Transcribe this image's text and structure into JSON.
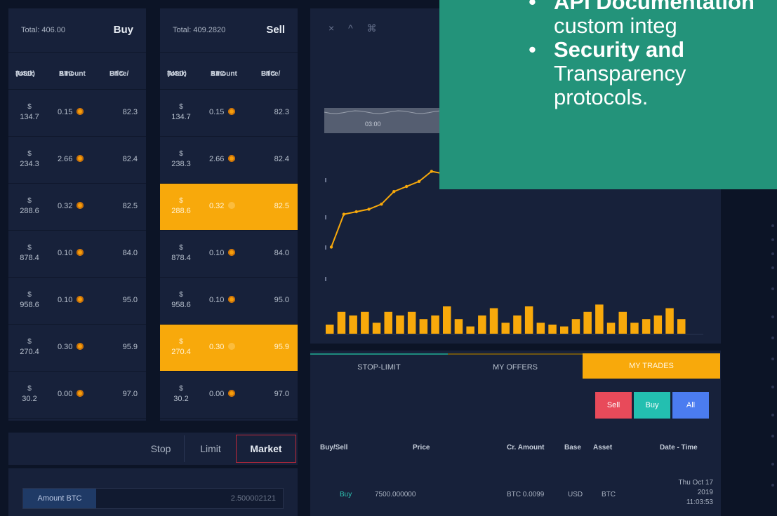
{
  "buy_book": {
    "total": "Total: 406.00",
    "side": "Buy",
    "columns": [
      {
        "l1": "Total:",
        "l2": "(USD)"
      },
      {
        "l1": "BTC",
        "l2": "Amount"
      },
      {
        "l1": "Price/",
        "l2": "BTC"
      }
    ],
    "rows": [
      {
        "sym": "$",
        "usd": "134.7",
        "amt": "0.15",
        "price": "82.3",
        "hl": false
      },
      {
        "sym": "$",
        "usd": "234.3",
        "amt": "2.66",
        "price": "82.4",
        "hl": false
      },
      {
        "sym": "$",
        "usd": "288.6",
        "amt": "0.32",
        "price": "82.5",
        "hl": false
      },
      {
        "sym": "$",
        "usd": "878.4",
        "amt": "0.10",
        "price": "84.0",
        "hl": false
      },
      {
        "sym": "$",
        "usd": "958.6",
        "amt": "0.10",
        "price": "95.0",
        "hl": false
      },
      {
        "sym": "$",
        "usd": "270.4",
        "amt": "0.30",
        "price": "95.9",
        "hl": false
      },
      {
        "sym": "$",
        "usd": "30.2",
        "amt": "0.00",
        "price": "97.0",
        "hl": false
      }
    ]
  },
  "sell_book": {
    "total": "Total: 409.2820",
    "side": "Sell",
    "columns": [
      {
        "l1": "Total:",
        "l2": "(USD)"
      },
      {
        "l1": "BTC",
        "l2": "Amount"
      },
      {
        "l1": "Price/",
        "l2": "BTC"
      }
    ],
    "rows": [
      {
        "sym": "$",
        "usd": "134.7",
        "amt": "0.15",
        "price": "82.3",
        "hl": false
      },
      {
        "sym": "$",
        "usd": "238.3",
        "amt": "2.66",
        "price": "82.4",
        "hl": false
      },
      {
        "sym": "$",
        "usd": "288.6",
        "amt": "0.32",
        "price": "82.5",
        "hl": true
      },
      {
        "sym": "$",
        "usd": "878.4",
        "amt": "0.10",
        "price": "84.0",
        "hl": false
      },
      {
        "sym": "$",
        "usd": "958.6",
        "amt": "0.10",
        "price": "95.0",
        "hl": false
      },
      {
        "sym": "$",
        "usd": "270.4",
        "amt": "0.30",
        "price": "95.9",
        "hl": true
      },
      {
        "sym": "$",
        "usd": "30.2",
        "amt": "0.00",
        "price": "97.0",
        "hl": false
      }
    ]
  },
  "order_type": {
    "stop": "Stop",
    "limit": "Limit",
    "market": "Market",
    "active": "Market"
  },
  "amount": {
    "label": "Amount BTC",
    "value": "2.500002121"
  },
  "chart": {
    "tools": "× ^ ⌘",
    "navigator_label": "03:00",
    "price_series": [
      22,
      48,
      50,
      52,
      56,
      66,
      70,
      74,
      82,
      80,
      86,
      92,
      86,
      88,
      90,
      84,
      88,
      82,
      78,
      80,
      76,
      78,
      76,
      70,
      72,
      74,
      74,
      76,
      82
    ],
    "volume_series": [
      5,
      12,
      10,
      12,
      6,
      12,
      10,
      12,
      8,
      10,
      15,
      8,
      4,
      10,
      14,
      6,
      10,
      15,
      6,
      5,
      4,
      8,
      12,
      16,
      6,
      12,
      6,
      8,
      10,
      14,
      8
    ],
    "colors": {
      "line": "#f8a90b",
      "bars": "#f8a90b",
      "navigator": "#6b7384"
    }
  },
  "trades": {
    "tabs": {
      "stop": "STOP-LIMIT",
      "offers": "MY OFFERS",
      "trades": "MY TRADES",
      "active": "MY TRADES"
    },
    "filters": {
      "sell": "Sell",
      "buy": "Buy",
      "all": "All"
    },
    "headers": {
      "side": "Buy/Sell",
      "price": "Price",
      "amount": "Cr. Amount",
      "base": "Base",
      "asset": "Asset",
      "time": "Date - Time"
    },
    "row": {
      "side": "Buy",
      "price": "7500.000000",
      "amount": "BTC 0.0099",
      "base": "USD",
      "asset": "BTC",
      "date1": "Thu Oct 17",
      "date2": "2019",
      "time": "11:03:53"
    }
  },
  "overlay": {
    "item1_title": "API Documentation",
    "item1_desc": "custom integ",
    "item2_title": "Security and",
    "item2_desc1": "Transparency",
    "item2_desc2": "protocols."
  },
  "colors": {
    "accent": "#f8a90b",
    "teal": "#23937a",
    "sell": "#e84a5a",
    "buy": "#23bfb0",
    "all": "#4b7cf0",
    "background": "#0c1426",
    "panel": "#17213a"
  }
}
